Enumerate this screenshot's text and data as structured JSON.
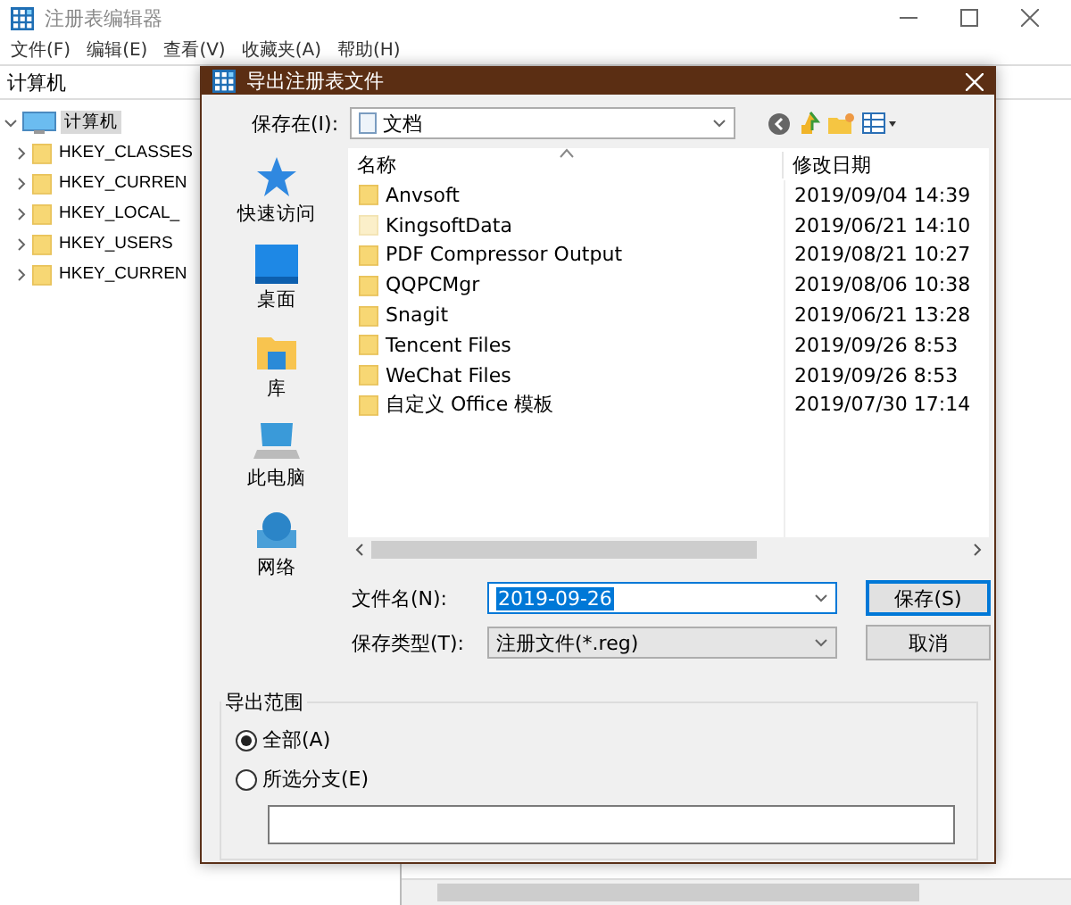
{
  "window": {
    "title": "注册表编辑器",
    "menu": [
      "文件(F)",
      "编辑(E)",
      "查看(V)",
      "收藏夹(A)",
      "帮助(H)"
    ]
  },
  "address": "计算机",
  "tree": [
    {
      "label": "计算机",
      "selected": true,
      "expanded": true,
      "children": [
        {
          "label": "HKEY_CLASSES",
          "selected": false
        },
        {
          "label": "HKEY_CURREN",
          "selected": false
        },
        {
          "label": "HKEY_LOCAL_",
          "selected": false
        },
        {
          "label": "HKEY_USERS",
          "selected": false
        },
        {
          "label": "HKEY_CURREN",
          "selected": false
        }
      ]
    }
  ],
  "dialog": {
    "title": "导出注册表文件",
    "save_in_label": "保存在(I):",
    "save_in_value": "文档",
    "places": [
      {
        "label": "快速访问",
        "kind": "star"
      },
      {
        "label": "桌面",
        "kind": "desktop"
      },
      {
        "label": "库",
        "kind": "library"
      },
      {
        "label": "此电脑",
        "kind": "computer"
      },
      {
        "label": "网络",
        "kind": "network"
      }
    ],
    "columns": [
      "名称",
      "修改日期"
    ],
    "files": [
      {
        "name": "Anvsoft",
        "date": "2019/09/04 14:39",
        "hidden": false
      },
      {
        "name": "KingsoftData",
        "date": "2019/06/21 14:10",
        "hidden": true
      },
      {
        "name": "PDF Compressor Output",
        "date": "2019/08/21 10:27",
        "hidden": false
      },
      {
        "name": "QQPCMgr",
        "date": "2019/08/06 10:38",
        "hidden": false
      },
      {
        "name": "Snagit",
        "date": "2019/06/21 13:28",
        "hidden": false
      },
      {
        "name": "Tencent Files",
        "date": "2019/09/26 8:53",
        "hidden": false
      },
      {
        "name": "WeChat Files",
        "date": "2019/09/26 8:53",
        "hidden": false
      },
      {
        "name": "自定义 Office 模板",
        "date": "2019/07/30 17:14",
        "hidden": false
      }
    ],
    "filename_label": "文件名(N):",
    "filename_value": "2019-09-26",
    "filetype_label": "保存类型(T):",
    "filetype_value": "注册文件(*.reg)",
    "buttons": [
      "保存(S)",
      "取消"
    ],
    "range": {
      "title": "导出范围",
      "options": [
        {
          "label": "全部(A)",
          "selected": true
        },
        {
          "label": "所选分支(E)",
          "selected": false
        }
      ]
    }
  }
}
